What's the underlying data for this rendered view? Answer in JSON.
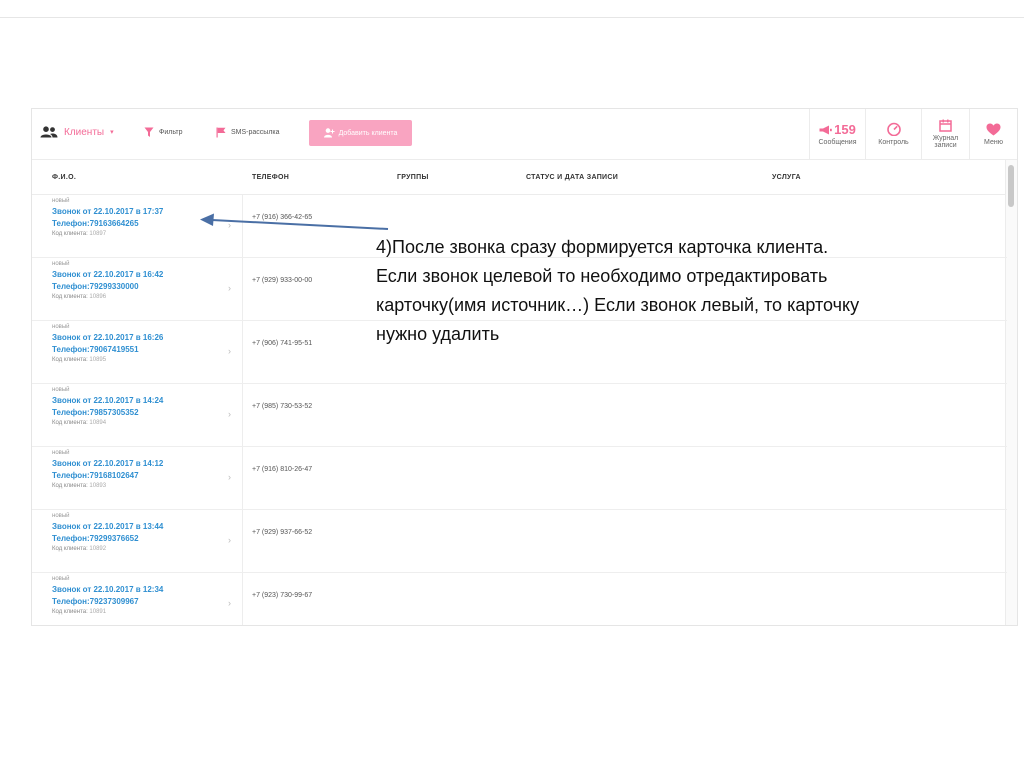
{
  "toolbar": {
    "clients_label": "Клиенты",
    "filter_label": "Фильтр",
    "sms_label": "SMS-рассылка",
    "add_client_label": "Добавить клиента"
  },
  "right_tools": {
    "messages": {
      "count": "159",
      "label": "Сообщения"
    },
    "control": {
      "label": "Контроль"
    },
    "journal": {
      "label_line1": "Журнал",
      "label_line2": "записи"
    },
    "menu": {
      "label": "Меню"
    }
  },
  "table": {
    "headers": [
      "Ф.И.О.",
      "ТЕЛЕФОН",
      "ГРУППЫ",
      "СТАТУС И ДАТА ЗАПИСИ",
      "УСЛУГА"
    ],
    "code_label": "Код клиента:",
    "rows": [
      {
        "status": "новый",
        "title": "Звонок от 22.10.2017 в 17:37",
        "phone_line": "Телефон:79163664265",
        "code": "10897",
        "phone": "+7 (916) 366-42-65"
      },
      {
        "status": "новый",
        "title": "Звонок от 22.10.2017 в 16:42",
        "phone_line": "Телефон:79299330000",
        "code": "10896",
        "phone": "+7 (929) 933-00-00"
      },
      {
        "status": "новый",
        "title": "Звонок от 22.10.2017 в 16:26",
        "phone_line": "Телефон:79067419551",
        "code": "10895",
        "phone": "+7 (906) 741-95-51"
      },
      {
        "status": "новый",
        "title": "Звонок от 22.10.2017 в 14:24",
        "phone_line": "Телефон:79857305352",
        "code": "10894",
        "phone": "+7 (985) 730-53-52"
      },
      {
        "status": "новый",
        "title": "Звонок от 22.10.2017 в 14:12",
        "phone_line": "Телефон:79168102647",
        "code": "10893",
        "phone": "+7 (916) 810-26-47"
      },
      {
        "status": "новый",
        "title": "Звонок от 22.10.2017 в 13:44",
        "phone_line": "Телефон:79299376652",
        "code": "10892",
        "phone": "+7 (929) 937-66-52"
      },
      {
        "status": "новый",
        "title": "Звонок от 22.10.2017 в 12:34",
        "phone_line": "Телефон:79237309967",
        "code": "10891",
        "phone": "+7 (923) 730-99-67"
      }
    ]
  },
  "annotation": {
    "lines": [
      "4)После звонка сразу формируется карточка клиента.",
      "Если звонок целевой то необходимо отредактировать",
      "карточку(имя источник…) Если звонок левый, то карточку",
      "нужно удалить"
    ]
  },
  "colors": {
    "accent": "#f36b97",
    "button": "#f9a4c1",
    "link": "#2f8fd1",
    "arrow": "#4a6fa5"
  }
}
